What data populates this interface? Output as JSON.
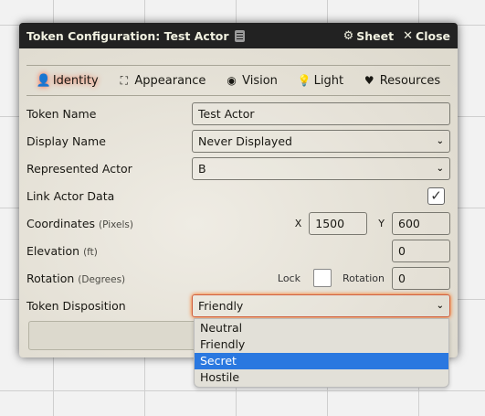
{
  "header": {
    "title": "Token Configuration: Test Actor",
    "title_icon": "id-card-icon",
    "sheet_label": "Sheet",
    "sheet_icon": "gear-icon",
    "close_label": "Close",
    "close_icon": "close-icon"
  },
  "tabs": [
    {
      "label": "Identity",
      "icon": "person-icon",
      "active": true
    },
    {
      "label": "Appearance",
      "icon": "expand-icon",
      "active": false
    },
    {
      "label": "Vision",
      "icon": "eye-icon",
      "active": false
    },
    {
      "label": "Light",
      "icon": "lightbulb-icon",
      "active": false
    },
    {
      "label": "Resources",
      "icon": "heart-icon",
      "active": false
    }
  ],
  "form": {
    "token_name": {
      "label": "Token Name",
      "value": "Test Actor"
    },
    "display_name": {
      "label": "Display Name",
      "value": "Never Displayed"
    },
    "represented_actor": {
      "label": "Represented Actor",
      "value": "B"
    },
    "link_actor": {
      "label": "Link Actor Data",
      "checked": true
    },
    "coordinates": {
      "label": "Coordinates",
      "hint": "(Pixels)",
      "x_label": "X",
      "x_value": "1500",
      "y_label": "Y",
      "y_value": "600"
    },
    "elevation": {
      "label": "Elevation",
      "hint": "(ft)",
      "value": "0"
    },
    "rotation": {
      "label": "Rotation",
      "hint": "(Degrees)",
      "lock_label": "Lock",
      "rotation_label": "Rotation",
      "value": "0"
    },
    "disposition": {
      "label": "Token Disposition",
      "value": "Friendly"
    }
  },
  "dropdown": {
    "options": [
      "Neutral",
      "Friendly",
      "Secret",
      "Hostile"
    ],
    "highlighted": "Secret"
  },
  "colors": {
    "accent_glow": "#ff6400",
    "highlight": "#2a78e0",
    "header_bg": "#222222"
  }
}
